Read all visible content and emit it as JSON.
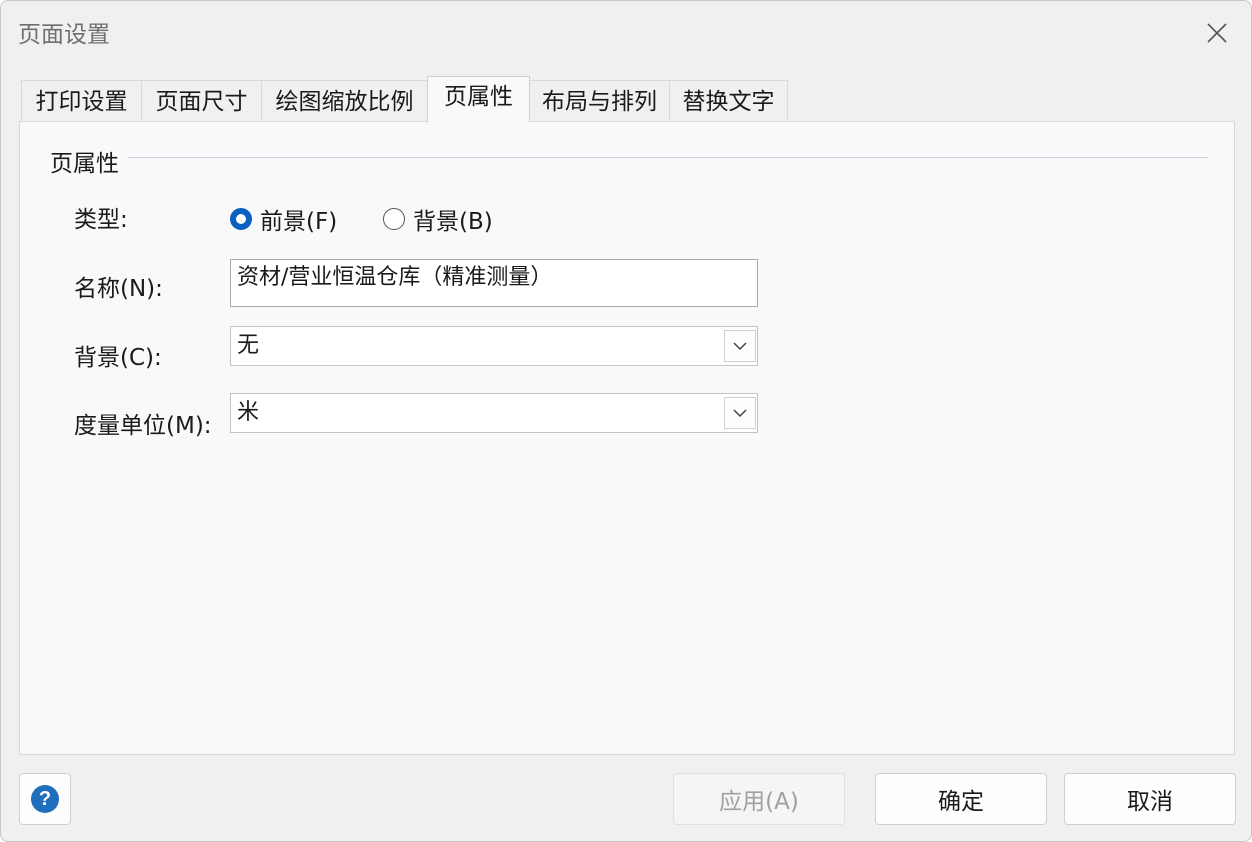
{
  "window": {
    "title": "页面设置",
    "close_icon": "close-icon"
  },
  "tabs": [
    {
      "label": "打印设置",
      "active": false
    },
    {
      "label": "页面尺寸",
      "active": false
    },
    {
      "label": "绘图缩放比例",
      "active": false
    },
    {
      "label": "页属性",
      "active": true
    },
    {
      "label": "布局与排列",
      "active": false
    },
    {
      "label": "替换文字",
      "active": false
    }
  ],
  "page_properties": {
    "group_title": "页属性",
    "type_label": "类型:",
    "type_options": [
      {
        "label": "前景(F)",
        "checked": true
      },
      {
        "label": "背景(B)",
        "checked": false
      }
    ],
    "name_label": "名称(N):",
    "name_value": "资材/营业恒温仓库（精准测量）",
    "background_label": "背景(C):",
    "background_value": "无",
    "unit_label": "度量单位(M):",
    "unit_value": "米"
  },
  "footer": {
    "help_icon": "help-icon",
    "apply_label": "应用(A)",
    "ok_label": "确定",
    "cancel_label": "取消"
  },
  "colors": {
    "accent": "#0a60c0",
    "help_icon": "#1f6fbd",
    "group_line": "#c7d4e2"
  }
}
